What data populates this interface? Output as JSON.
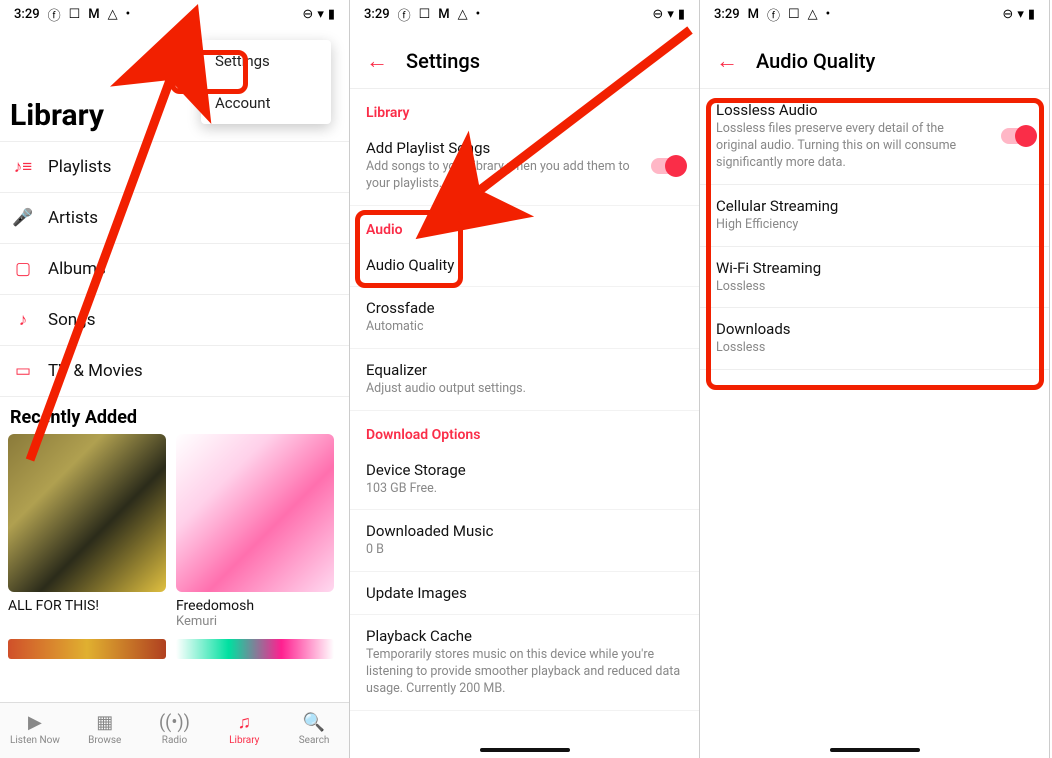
{
  "statusbar": {
    "time": "3:29",
    "icons_left": [
      "facebook-icon",
      "overscan-icon",
      "gmail-icon",
      "drive-icon",
      "dot-icon"
    ],
    "icons_right": [
      "do-not-disturb-icon",
      "wifi-icon",
      "battery-icon"
    ]
  },
  "library": {
    "title": "Library",
    "items": [
      {
        "icon": "playlist-icon",
        "label": "Playlists"
      },
      {
        "icon": "microphone-icon",
        "label": "Artists"
      },
      {
        "icon": "album-icon",
        "label": "Albums"
      },
      {
        "icon": "note-icon",
        "label": "Songs"
      },
      {
        "icon": "tv-icon",
        "label": "TV & Movies"
      }
    ],
    "recently_added": "Recently Added",
    "albums": [
      {
        "title": "ALL FOR THIS!",
        "artist": ""
      },
      {
        "title": "Freedomosh",
        "artist": "Kemuri"
      }
    ]
  },
  "popup": {
    "settings": "Settings",
    "account": "Account"
  },
  "tabs": [
    {
      "icon": "play-circle-icon",
      "label": "Listen Now"
    },
    {
      "icon": "grid-icon",
      "label": "Browse"
    },
    {
      "icon": "radio-icon",
      "label": "Radio"
    },
    {
      "icon": "library-icon",
      "label": "Library"
    },
    {
      "icon": "search-icon",
      "label": "Search"
    }
  ],
  "settings": {
    "title": "Settings",
    "sections": {
      "library": "Library",
      "audio": "Audio",
      "download": "Download Options"
    },
    "add_playlist": {
      "title": "Add Playlist Songs",
      "sub": "Add songs to your library when you add them to your playlists."
    },
    "audio_quality": "Audio Quality",
    "crossfade": {
      "title": "Crossfade",
      "sub": "Automatic"
    },
    "equalizer": {
      "title": "Equalizer",
      "sub": "Adjust audio output settings."
    },
    "device_storage": {
      "title": "Device Storage",
      "sub": "103 GB Free."
    },
    "downloaded_music": {
      "title": "Downloaded Music",
      "sub": "0 B"
    },
    "update_images": {
      "title": "Update Images"
    },
    "playback_cache": {
      "title": "Playback Cache",
      "sub": "Temporarily stores music on this device while you're listening to provide smoother playback and reduced data usage. Currently 200 MB."
    }
  },
  "audio_quality": {
    "title": "Audio Quality",
    "lossless": {
      "title": "Lossless Audio",
      "sub": "Lossless files preserve every detail of the original audio. Turning this on will consume significantly more data."
    },
    "cellular": {
      "title": "Cellular Streaming",
      "sub": "High Efficiency"
    },
    "wifi": {
      "title": "Wi-Fi Streaming",
      "sub": "Lossless"
    },
    "downloads": {
      "title": "Downloads",
      "sub": "Lossless"
    }
  }
}
